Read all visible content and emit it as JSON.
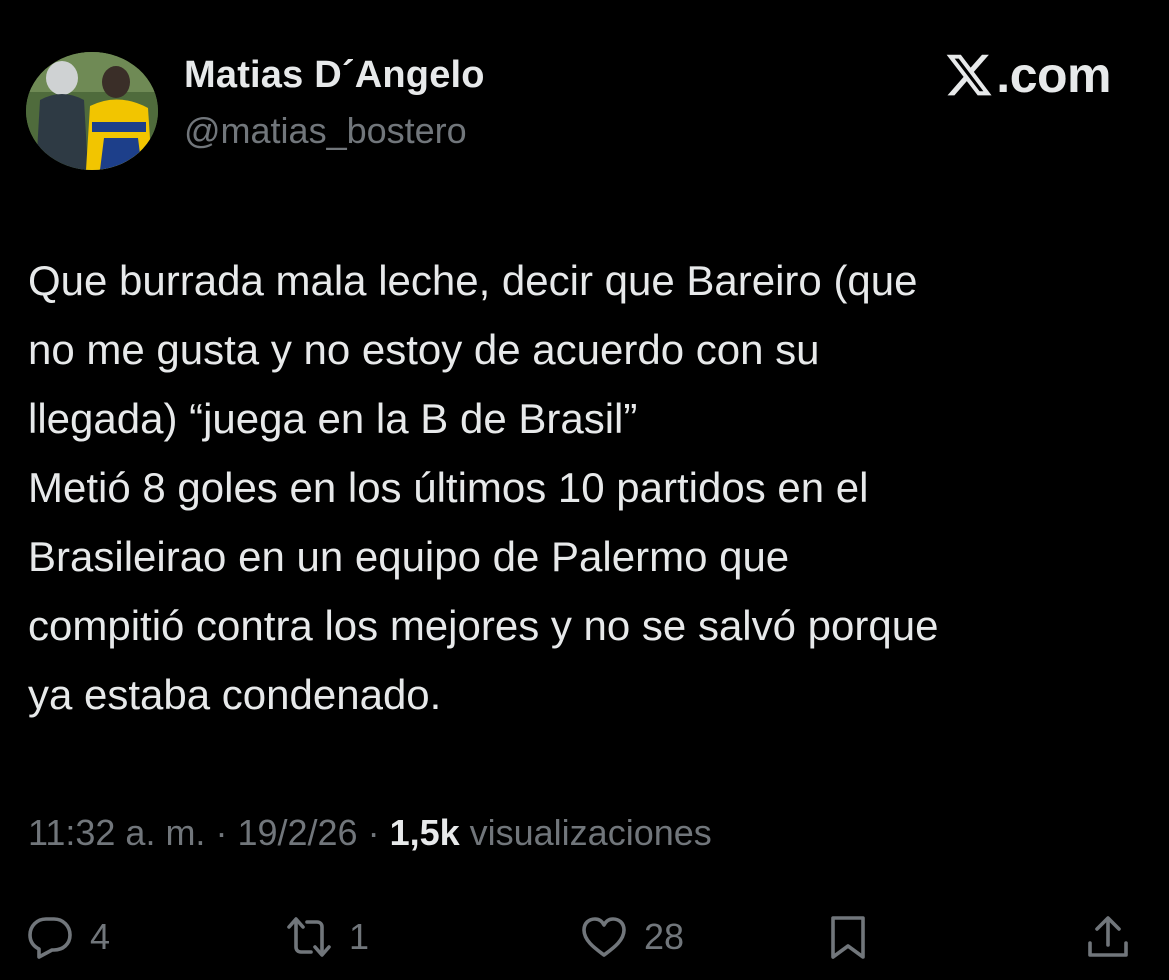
{
  "author": {
    "display_name": "Matias D´Angelo",
    "handle": "@matias_bostero",
    "avatar": "profile-photo"
  },
  "brand": {
    "logo": "x-logo-icon",
    "text": ".com"
  },
  "tweet": {
    "text": "Que burrada mala leche, decir que Bareiro (que\nno me gusta y no estoy de acuerdo con su\nllegada) “juega en la B de Brasil”\nMetió 8 goles en los últimos 10 partidos en el\nBrasileirao en un equipo de Palermo que\ncompitió contra los mejores y no se salvó porque\nya estaba condenado."
  },
  "meta": {
    "time": "11:32 a. m.",
    "separator": " · ",
    "date": "19/2/26",
    "views_count": "1,5k",
    "views_label": " visualizaciones"
  },
  "actions": {
    "reply": {
      "icon": "reply-icon",
      "count": "4"
    },
    "repost": {
      "icon": "repost-icon",
      "count": "1"
    },
    "like": {
      "icon": "heart-icon",
      "count": "28"
    },
    "bookmark": {
      "icon": "bookmark-icon"
    },
    "share": {
      "icon": "share-icon"
    }
  },
  "colors": {
    "background": "#000000",
    "primary_text": "#e7e9ea",
    "secondary_text": "#71767b"
  }
}
